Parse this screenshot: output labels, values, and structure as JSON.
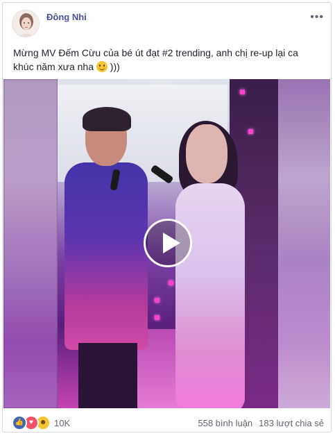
{
  "post": {
    "author": "Đông Nhi",
    "more_label": "•••",
    "text": "Mừng MV Đếm Cừu của bé út đạt #2 trending, anh chị re-up lại ca khúc năm xưa nha",
    "text_suffix": ")))",
    "emoji": "slightly-smiling-face"
  },
  "video": {
    "play_icon": "play-icon"
  },
  "footer": {
    "reactions": [
      "like-icon",
      "love-icon",
      "haha-icon"
    ],
    "reaction_count": "10K",
    "comments": "558 bình luận",
    "shares": "183 lượt chia sẻ"
  },
  "colors": {
    "author": "#4b4f9c",
    "like": "#4267b2",
    "love": "#f25268",
    "haha": "#f7c531",
    "meta_text": "#606770"
  }
}
